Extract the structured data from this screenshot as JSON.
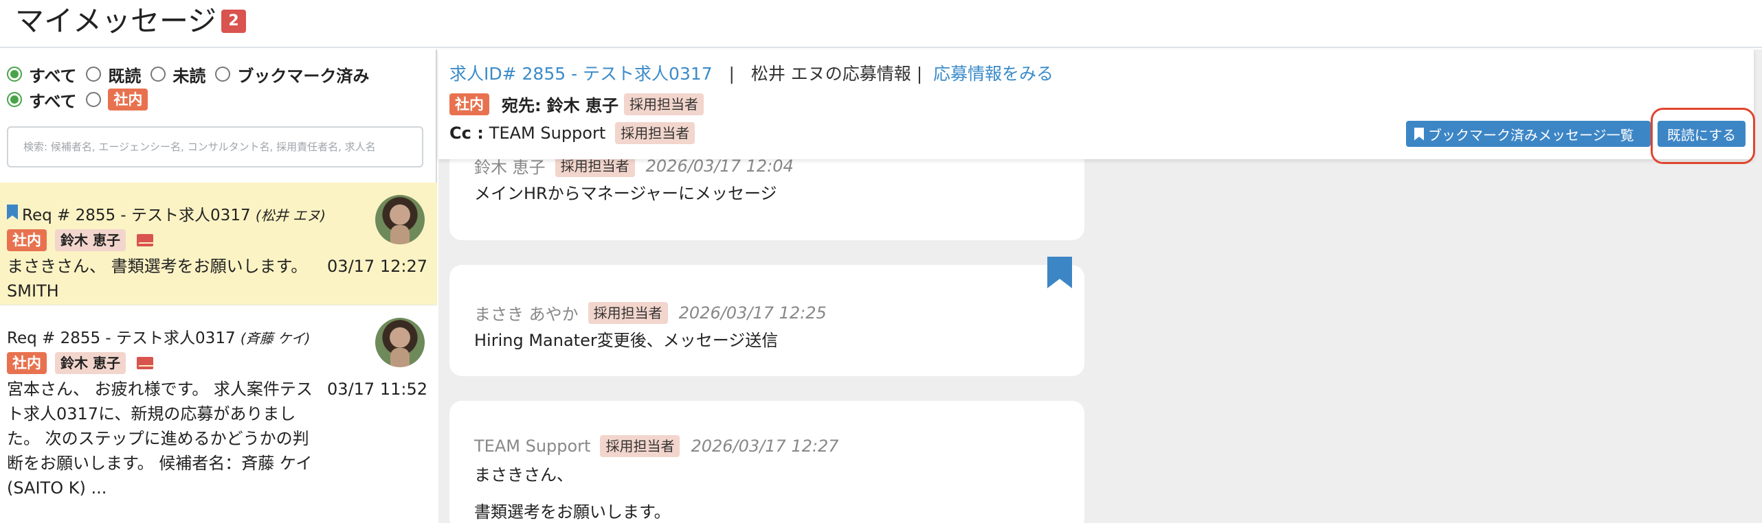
{
  "header": {
    "title": "マイメッセージ",
    "badge": "2"
  },
  "filters": {
    "row1": {
      "all": "すべて",
      "read": "既読",
      "unread": "未読",
      "bookmarked": "ブックマーク済み"
    },
    "row2": {
      "all": "すべて",
      "internal": "社内"
    }
  },
  "search": {
    "placeholder": "検索: 候補者名, エージェンシー名, コンサルタント名, 採用責任者名, 求人名"
  },
  "messages": [
    {
      "req": "Req # 2855 - テスト求人0317",
      "candidate": "(松井 エヌ)",
      "tag": "社内",
      "name": "鈴木 恵子",
      "preview_lines": [
        "まさきさん、 書類選考をお願いします。",
        "SMITH"
      ],
      "time": "03/17 12:27"
    },
    {
      "req": "Req # 2855 - テスト求人0317",
      "candidate": "(斉藤 ケイ)",
      "tag": "社内",
      "name": "鈴木 恵子",
      "preview_lines": [
        "宮本さん、 お疲れ様です。 求人案件テス",
        "ト求人0317に、新規の応募がありまし",
        "た。 次のステップに進めるかどうかの判",
        "断をお願いします。 候補者名：斉藤 ケイ",
        "(SAITO K) ..."
      ],
      "time": "03/17 11:52"
    }
  ],
  "detail": {
    "job_link": "求人ID# 2855 - テスト求人0317",
    "separator": "|",
    "applicant_info": "松井 エヌの応募情報 |",
    "view_link": "応募情報をみる",
    "tag": "社内",
    "to_label": "宛先:",
    "to_name": "鈴木 恵子",
    "to_role": "採用担当者",
    "cc_label": "Cc :",
    "cc_name": "TEAM Support",
    "cc_role": "採用担当者",
    "btn_bookmark_list": "ブックマーク済みメッセージ一覧",
    "btn_mark_read": "既読にする"
  },
  "thread": [
    {
      "sender": "鈴木 恵子",
      "role": "採用担当者",
      "date": "2026/03/17 12:04",
      "lines": [
        "メインHRからマネージャーにメッセージ"
      ]
    },
    {
      "sender": "まさき あやか",
      "role": "採用担当者",
      "date": "2026/03/17 12:25",
      "lines": [
        "Hiring Manater変更後、メッセージ送信"
      ]
    },
    {
      "sender": "TEAM Support",
      "role": "採用担当者",
      "date": "2026/03/17 12:27",
      "lines": [
        "まさきさん、",
        "書類選考をお願いします。"
      ]
    }
  ],
  "colors": {
    "accent": "#3d86c6",
    "internal_tag": "#e8724f",
    "role_tag": "#f2d5cc",
    "selected_row": "#fcf3c4",
    "highlight": "#e0452f"
  }
}
